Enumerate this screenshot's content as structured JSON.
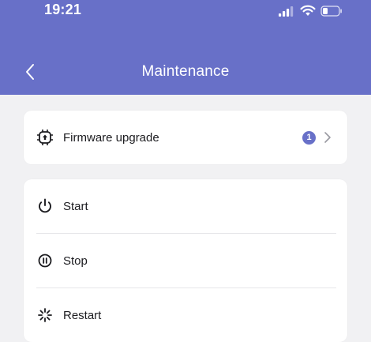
{
  "status_bar": {
    "time": "19:21",
    "icons": [
      "signal-icon",
      "wifi-icon",
      "battery-icon"
    ]
  },
  "header": {
    "title": "Maintenance",
    "back_icon": "chevron-left-icon"
  },
  "firmware": {
    "label": "Firmware upgrade",
    "badge_count": "1",
    "icon": "chip-icon"
  },
  "actions": {
    "items": [
      {
        "label": "Start",
        "icon": "power-icon"
      },
      {
        "label": "Stop",
        "icon": "stop-icon"
      },
      {
        "label": "Restart",
        "icon": "restart-icon"
      }
    ]
  },
  "colors": {
    "accent": "#6870c8",
    "background": "#f1f1f3",
    "card": "#ffffff"
  }
}
